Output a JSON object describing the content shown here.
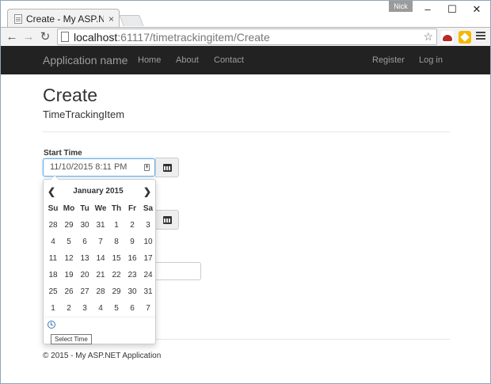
{
  "browser": {
    "tab_title": "Create - My ASP.NET App",
    "tab_close": "×",
    "user": "Nick",
    "minimize": "–",
    "maximize": "☐",
    "close": "✕",
    "back": "←",
    "forward": "→",
    "reload": "↻",
    "url_host": "localhost",
    "url_path": ":61117/timetrackingitem/Create",
    "star": "☆"
  },
  "navbar": {
    "brand": "Application name",
    "links": [
      "Home",
      "About",
      "Contact"
    ],
    "right_links": [
      "Register",
      "Log in"
    ]
  },
  "page": {
    "title": "Create",
    "subtitle": "TimeTrackingItem"
  },
  "form": {
    "start_time_label": "Start Time",
    "start_time_value": "11/10/2015 8:11 PM"
  },
  "datepicker": {
    "prev": "❮",
    "next": "❯",
    "month_label": "January 2015",
    "weekdays": [
      "Su",
      "Mo",
      "Tu",
      "We",
      "Th",
      "Fr",
      "Sa"
    ],
    "weeks": [
      [
        "28",
        "29",
        "30",
        "31",
        "1",
        "2",
        "3"
      ],
      [
        "4",
        "5",
        "6",
        "7",
        "8",
        "9",
        "10"
      ],
      [
        "11",
        "12",
        "13",
        "14",
        "15",
        "16",
        "17"
      ],
      [
        "18",
        "19",
        "20",
        "21",
        "22",
        "23",
        "24"
      ],
      [
        "25",
        "26",
        "27",
        "28",
        "29",
        "30",
        "31"
      ],
      [
        "1",
        "2",
        "3",
        "4",
        "5",
        "6",
        "7"
      ]
    ],
    "tooltip": "Select Time"
  },
  "footer": {
    "text": "© 2015 - My ASP.NET Application"
  }
}
